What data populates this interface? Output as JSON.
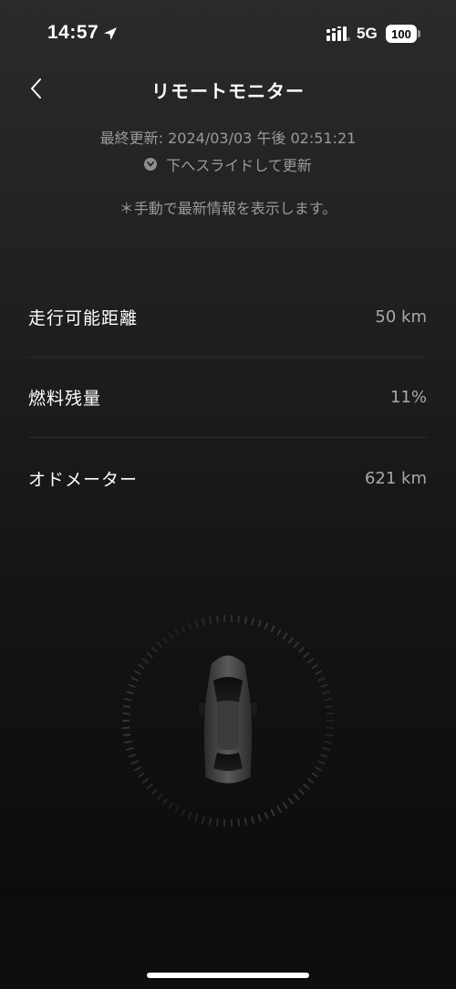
{
  "status_bar": {
    "time": "14:57",
    "network": "5G",
    "battery": "100",
    "icons": [
      "location-arrow-icon",
      "signal-bars-icon"
    ]
  },
  "header": {
    "back_icon": "chevron-left-icon",
    "title": "リモートモニター"
  },
  "update": {
    "last_updated": "最終更新: 2024/03/03 午後 02:51:21",
    "pull_hint_icon": "chevron-down-icon",
    "pull_hint": "下へスライドして更新",
    "manual_note": "＊手動で最新情報を表示します。"
  },
  "info": [
    {
      "label": "走行可能距離",
      "value": "50 km"
    },
    {
      "label": "燃料残量",
      "value": "11%"
    },
    {
      "label": "オドメーター",
      "value": "621 km"
    }
  ],
  "vehicle": {
    "icon": "car-top-view-icon",
    "accent_color": "#3a3a3a"
  }
}
